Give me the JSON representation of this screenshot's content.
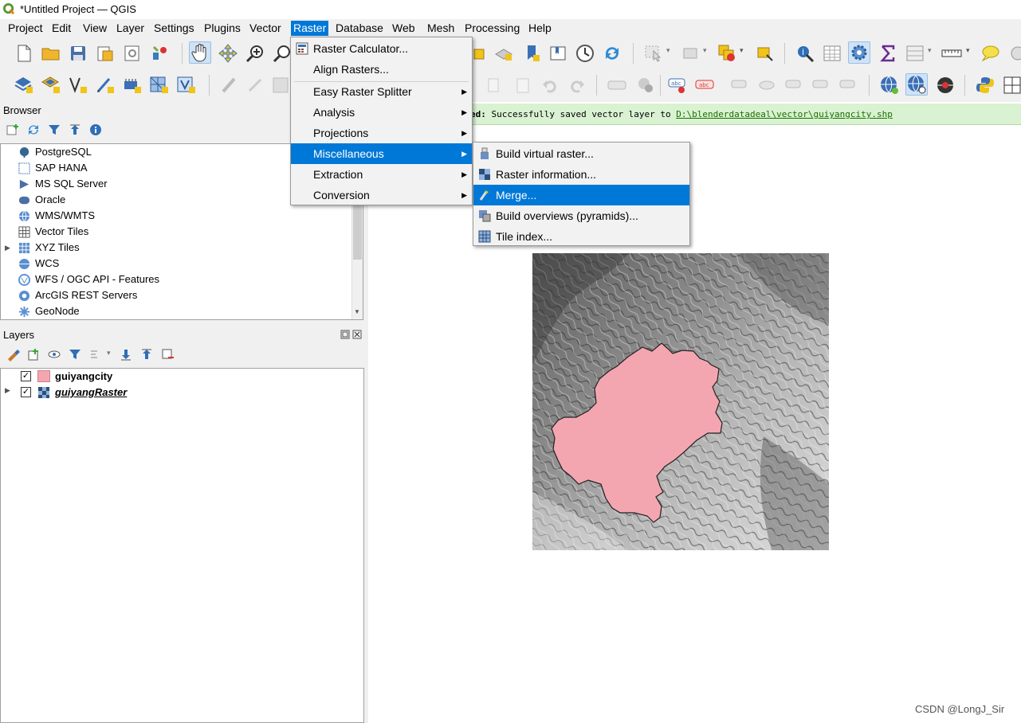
{
  "window": {
    "title": "*Untitled Project — QGIS"
  },
  "menubar": [
    {
      "label": "Project"
    },
    {
      "label": "Edit"
    },
    {
      "label": "View"
    },
    {
      "label": "Layer"
    },
    {
      "label": "Settings"
    },
    {
      "label": "Plugins"
    },
    {
      "label": "Vector"
    },
    {
      "label": "Raster"
    },
    {
      "label": "Database"
    },
    {
      "label": "Web"
    },
    {
      "label": "Mesh"
    },
    {
      "label": "Processing"
    },
    {
      "label": "Help"
    }
  ],
  "toolbar_icons": {
    "row1": [
      "new-project-icon",
      "open-project-icon",
      "save-project-icon",
      "save-as-icon",
      "print-layout-icon",
      "style-manager-icon",
      "pan-icon",
      "pan-to-selection-icon",
      "zoom-in-icon",
      "zoom-out-icon"
    ],
    "row1_right": [
      "identify-icon",
      "attribute-table-icon",
      "settings-gear-icon",
      "statistics-sum-icon",
      "open-table-icon",
      "measure-icon",
      "map-tips-icon"
    ]
  },
  "browser": {
    "title": "Browser",
    "items": [
      {
        "label": "PostgreSQL",
        "icon": "postgresql-icon"
      },
      {
        "label": "SAP HANA",
        "icon": "sap-hana-icon"
      },
      {
        "label": "MS SQL Server",
        "icon": "mssql-icon"
      },
      {
        "label": "Oracle",
        "icon": "oracle-icon"
      },
      {
        "label": "WMS/WMTS",
        "icon": "wms-icon"
      },
      {
        "label": "Vector Tiles",
        "icon": "vector-tiles-icon"
      },
      {
        "label": "XYZ Tiles",
        "icon": "xyz-tiles-icon"
      },
      {
        "label": "WCS",
        "icon": "wcs-icon"
      },
      {
        "label": "WFS / OGC API - Features",
        "icon": "wfs-icon"
      },
      {
        "label": "ArcGIS REST Servers",
        "icon": "arcgis-icon"
      },
      {
        "label": "GeoNode",
        "icon": "geonode-icon"
      }
    ]
  },
  "layers": {
    "title": "Layers",
    "items": [
      {
        "label": "guiyangcity",
        "checked": true,
        "color": "#f4a6b0"
      },
      {
        "label": "guiyangRaster",
        "checked": true
      }
    ]
  },
  "message": {
    "prefix": "ed:",
    "text": " Successfully saved vector layer to ",
    "link": "D:\\blenderdatadeal\\vector\\guiyangcity.shp"
  },
  "raster_menu": {
    "items": [
      {
        "label": "Raster Calculator...",
        "icon": "raster-calculator-icon"
      },
      {
        "label": "Align Rasters...",
        "icon": ""
      },
      {
        "label": "Easy Raster Splitter",
        "submenu": true
      },
      {
        "label": "Analysis",
        "submenu": true
      },
      {
        "label": "Projections",
        "submenu": true
      },
      {
        "label": "Miscellaneous",
        "submenu": true,
        "highlighted": true
      },
      {
        "label": "Extraction",
        "submenu": true
      },
      {
        "label": "Conversion",
        "submenu": true
      }
    ]
  },
  "misc_menu": {
    "items": [
      {
        "label": "Build virtual raster...",
        "icon": "build-vrt-icon"
      },
      {
        "label": "Raster information...",
        "icon": "raster-info-icon"
      },
      {
        "label": "Merge...",
        "icon": "merge-icon",
        "highlighted": true
      },
      {
        "label": "Build overviews (pyramids)...",
        "icon": "pyramids-icon"
      },
      {
        "label": "Tile index...",
        "icon": "tile-index-icon"
      }
    ]
  },
  "watermark": "CSDN @LongJ_Sir",
  "colors": {
    "accent": "#0078d7",
    "polygon": "#f4a6b0",
    "message_bg": "#d9f2d2"
  }
}
